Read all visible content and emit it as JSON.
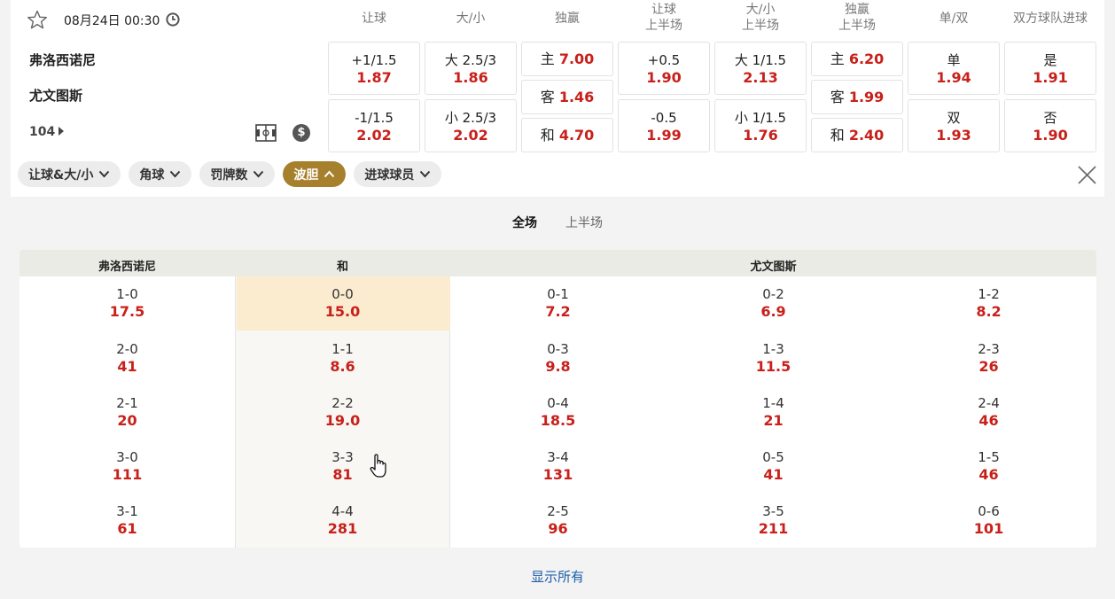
{
  "match": {
    "datetime": "08月24日 00:30",
    "home": "弗洛西诺尼",
    "away": "尤文图斯",
    "market_count": "104"
  },
  "columns": [
    "让球",
    "大/小",
    "独赢",
    "让球\n上半场",
    "大/小\n上半场",
    "独赢\n上半场",
    "单/双",
    "双方球队进球"
  ],
  "odds": {
    "handicap": [
      {
        "label": "+1/1.5",
        "odd": "1.87"
      },
      {
        "label": "-1/1.5",
        "odd": "2.02"
      }
    ],
    "over_under": [
      {
        "label": "大 2.5/3",
        "odd": "1.86"
      },
      {
        "label": "小 2.5/3",
        "odd": "2.02"
      }
    ],
    "moneyline": [
      {
        "label": "主",
        "odd": "7.00"
      },
      {
        "label": "客",
        "odd": "1.46"
      },
      {
        "label": "和",
        "odd": "4.70"
      }
    ],
    "handicap_1h": [
      {
        "label": "+0.5",
        "odd": "1.90"
      },
      {
        "label": "-0.5",
        "odd": "1.99"
      }
    ],
    "over_under_1h": [
      {
        "label": "大 1/1.5",
        "odd": "2.13"
      },
      {
        "label": "小 1/1.5",
        "odd": "1.76"
      }
    ],
    "moneyline_1h": [
      {
        "label": "主",
        "odd": "6.20"
      },
      {
        "label": "客",
        "odd": "1.99"
      },
      {
        "label": "和",
        "odd": "2.40"
      }
    ],
    "odd_even": [
      {
        "label": "单",
        "odd": "1.94"
      },
      {
        "label": "双",
        "odd": "1.93"
      }
    ],
    "btts": [
      {
        "label": "是",
        "odd": "1.91"
      },
      {
        "label": "否",
        "odd": "1.90"
      }
    ]
  },
  "filters": [
    {
      "label": "让球&大/小",
      "active": false
    },
    {
      "label": "角球",
      "active": false
    },
    {
      "label": "罚牌数",
      "active": false
    },
    {
      "label": "波胆",
      "active": true
    },
    {
      "label": "进球球员",
      "active": false
    }
  ],
  "score_tabs": [
    {
      "label": "全场",
      "active": true
    },
    {
      "label": "上半场",
      "active": false
    }
  ],
  "correct_score": {
    "headers": {
      "home": "弗洛西诺尼",
      "draw": "和",
      "away": "尤文图斯"
    },
    "columns": [
      [
        {
          "score": "1-0",
          "odd": "17.5"
        },
        {
          "score": "2-0",
          "odd": "41"
        },
        {
          "score": "2-1",
          "odd": "20"
        },
        {
          "score": "3-0",
          "odd": "111"
        },
        {
          "score": "3-1",
          "odd": "61"
        }
      ],
      [
        {
          "score": "0-0",
          "odd": "15.0",
          "selected": true
        },
        {
          "score": "1-1",
          "odd": "8.6"
        },
        {
          "score": "2-2",
          "odd": "19.0"
        },
        {
          "score": "3-3",
          "odd": "81"
        },
        {
          "score": "4-4",
          "odd": "281"
        }
      ],
      [
        {
          "score": "0-1",
          "odd": "7.2"
        },
        {
          "score": "0-3",
          "odd": "9.8"
        },
        {
          "score": "0-4",
          "odd": "18.5"
        },
        {
          "score": "3-4",
          "odd": "131"
        },
        {
          "score": "2-5",
          "odd": "96"
        }
      ],
      [
        {
          "score": "0-2",
          "odd": "6.9"
        },
        {
          "score": "1-3",
          "odd": "11.5"
        },
        {
          "score": "1-4",
          "odd": "21"
        },
        {
          "score": "0-5",
          "odd": "41"
        },
        {
          "score": "3-5",
          "odd": "211"
        }
      ],
      [
        {
          "score": "1-2",
          "odd": "8.2"
        },
        {
          "score": "2-3",
          "odd": "26"
        },
        {
          "score": "2-4",
          "odd": "46"
        },
        {
          "score": "1-5",
          "odd": "46"
        },
        {
          "score": "0-6",
          "odd": "101"
        }
      ]
    ]
  },
  "show_all": "显示所有",
  "colors": {
    "odd_red": "#c8201a",
    "active_chip": "#a7802d",
    "selected_cell": "#fbecd0",
    "link_blue": "#1d5fa8"
  }
}
